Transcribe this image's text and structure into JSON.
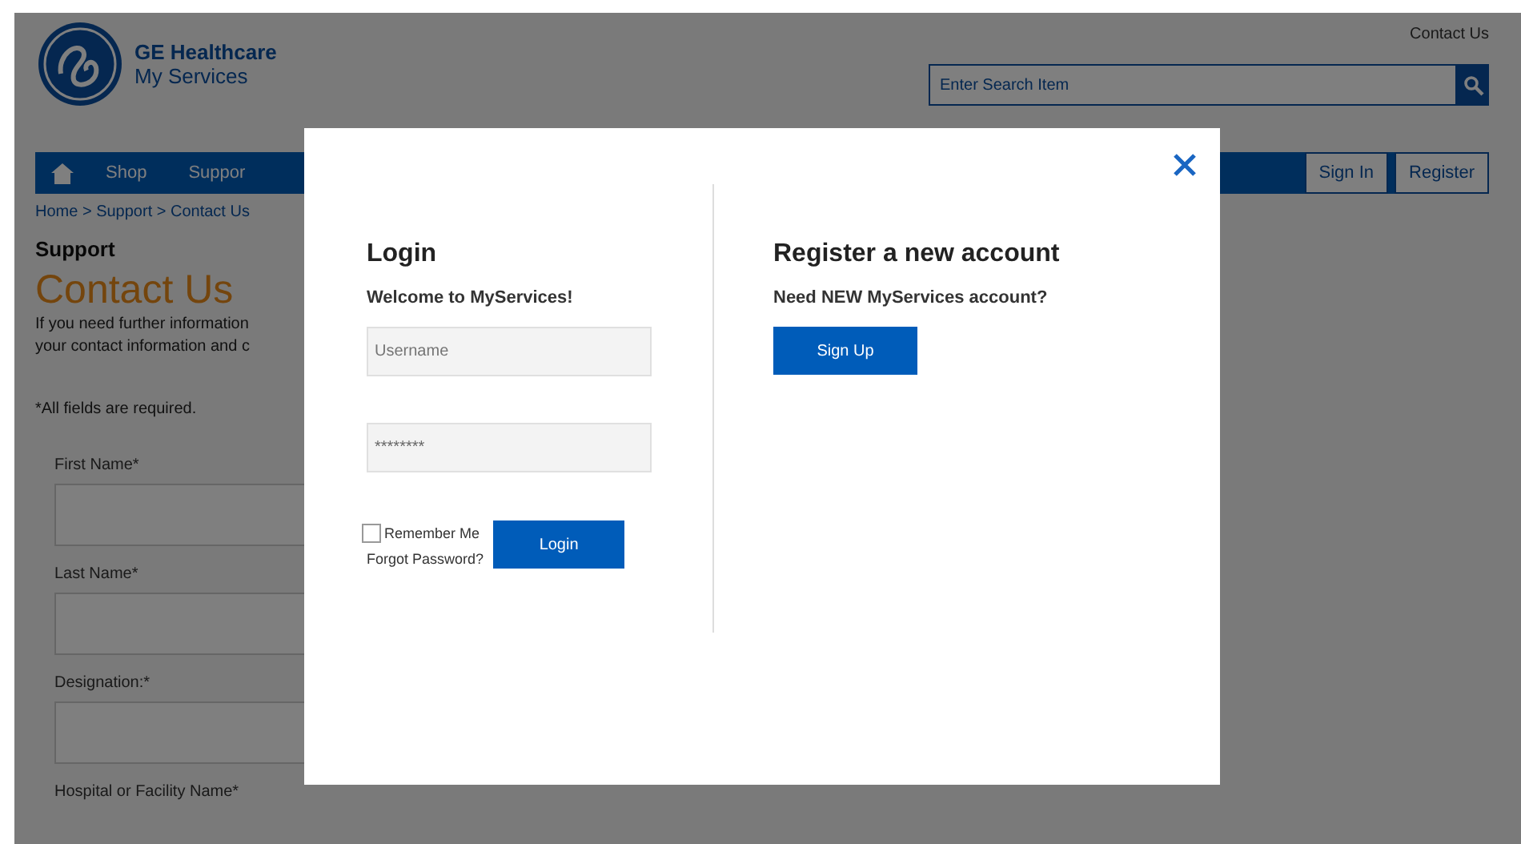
{
  "header": {
    "brand_line1": "GE Healthcare",
    "brand_line2": "My Services",
    "contact_link": "Contact Us",
    "search": {
      "placeholder": "Enter Search Item"
    }
  },
  "nav": {
    "items": [
      "Shop",
      "Suppor"
    ],
    "account_buttons": [
      "Sign In",
      "Register"
    ]
  },
  "breadcrumb": "Home > Support > Contact Us",
  "section": "Support",
  "page_title": "Contact Us",
  "intro_lines": [
    "If you need further information",
    "your contact information and c"
  ],
  "required_note": "*All fields are required.",
  "form_fields": [
    {
      "label": "First Name*"
    },
    {
      "label": "Last Name*"
    },
    {
      "label": "Designation:*"
    },
    {
      "label": "Hospital or Facility Name*"
    }
  ],
  "modal": {
    "login": {
      "title": "Login",
      "subtitle": "Welcome to MyServices!",
      "username": {
        "placeholder": "Username"
      },
      "password": {
        "value": "********"
      },
      "remember": {
        "label": "Remember Me",
        "checked": false
      },
      "forgot_link": "Forgot Password?",
      "button": "Login"
    },
    "register": {
      "title": "Register a new account",
      "subtitle": "Need NEW MyServices account?",
      "button": "Sign Up"
    }
  }
}
